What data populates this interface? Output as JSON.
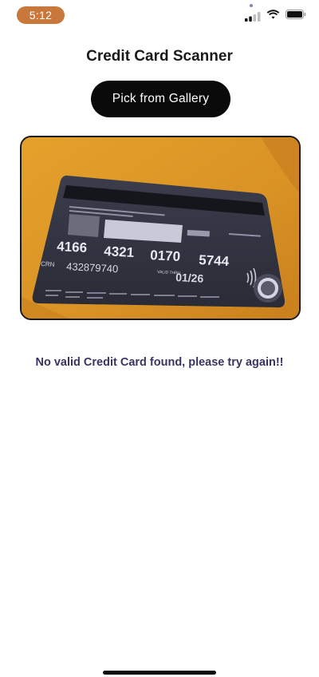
{
  "status_bar": {
    "time": "5:12",
    "icons": [
      "cellular-signal-icon",
      "wifi-icon",
      "battery-icon"
    ]
  },
  "header": {
    "title": "Credit Card Scanner"
  },
  "actions": {
    "pick_gallery_label": "Pick from Gallery"
  },
  "scanned_image": {
    "description_icon": "credit-card-photo",
    "card_number_groups": [
      "4166",
      "4321",
      "0170",
      "5744"
    ],
    "crn_label": "CRN",
    "crn_value": "432879740",
    "valid_label": "VALID THRU",
    "expiry": "01/26",
    "background_color": "#df9a26"
  },
  "result": {
    "message": "No valid Credit Card found, please try again!!"
  },
  "colors": {
    "time_pill": "#c8783a",
    "button_bg": "#0a0a0a",
    "message_text": "#3a3560"
  }
}
